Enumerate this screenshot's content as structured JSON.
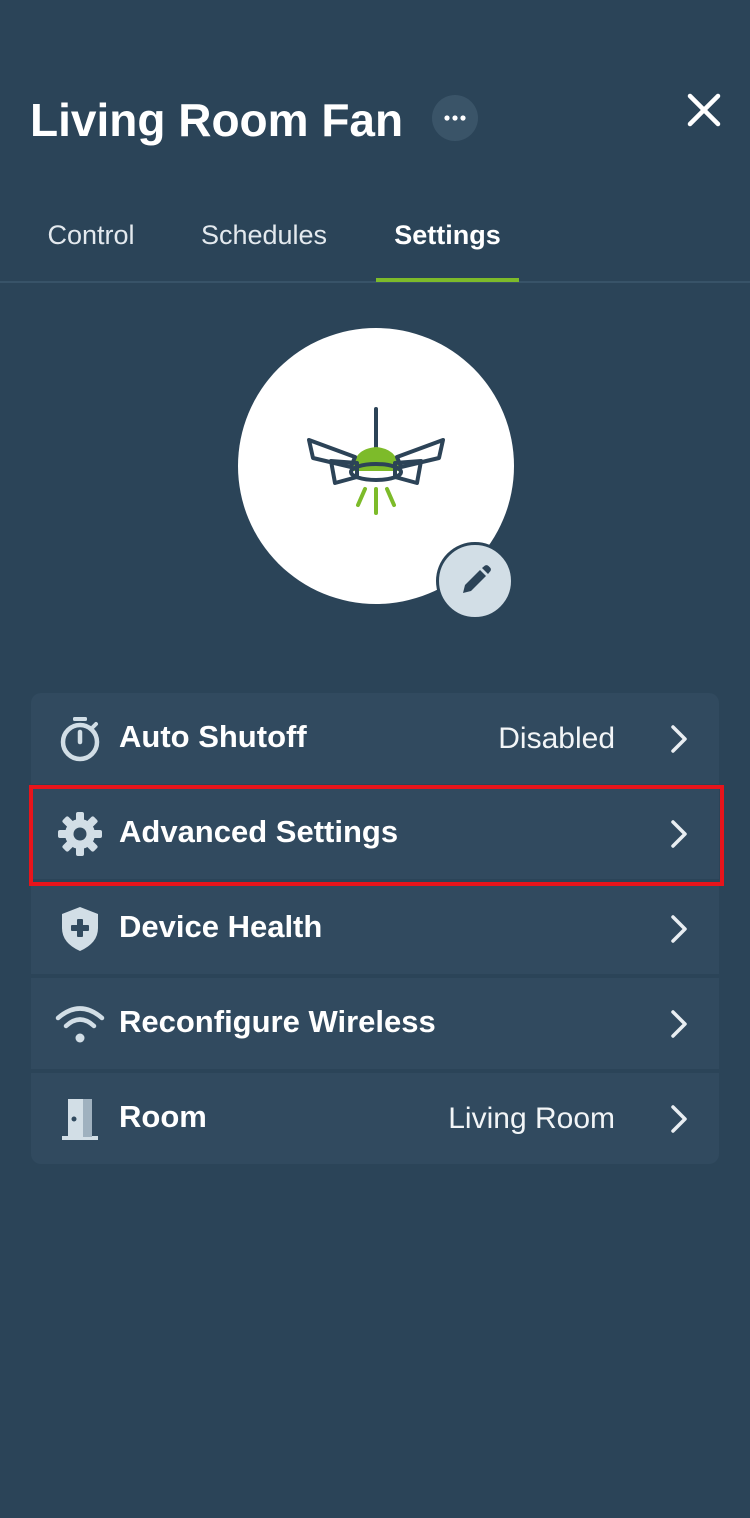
{
  "header": {
    "title": "Living Room Fan",
    "more_icon": "more-horizontal-icon",
    "close_icon": "close-icon"
  },
  "tabs": [
    {
      "label": "Control",
      "active": false
    },
    {
      "label": "Schedules",
      "active": false
    },
    {
      "label": "Settings",
      "active": true
    }
  ],
  "device": {
    "image_icon": "ceiling-fan-light-icon",
    "edit_icon": "pencil-icon"
  },
  "settings_list": {
    "items": [
      {
        "label": "Auto Shutoff",
        "value": "Disabled",
        "icon": "timer-icon"
      },
      {
        "label": "Advanced Settings",
        "value": "",
        "icon": "gear-icon"
      },
      {
        "label": "Device Health",
        "value": "",
        "icon": "shield-plus-icon"
      },
      {
        "label": "Reconfigure Wireless",
        "value": "",
        "icon": "wifi-icon"
      },
      {
        "label": "Room",
        "value": "Living Room",
        "icon": "door-icon"
      }
    ]
  },
  "colors": {
    "background": "#2b4458",
    "row_background": "#314a5f",
    "accent": "#7dbb2a",
    "highlight": "#e8141b",
    "icon_light": "#d2dee6"
  }
}
